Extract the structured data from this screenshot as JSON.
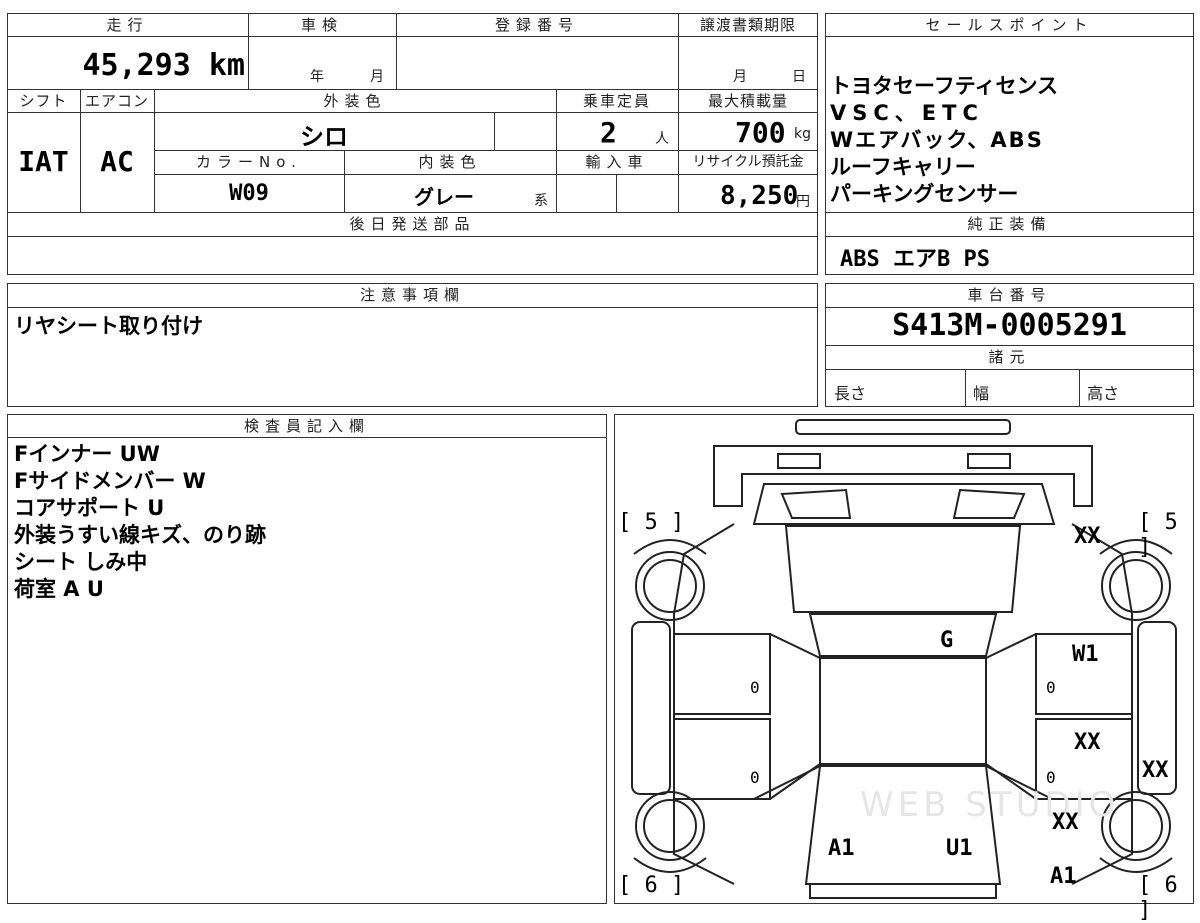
{
  "mileage": {
    "header": "走行",
    "value": "45,293 km"
  },
  "inspection": {
    "header": "車検",
    "year_label": "年",
    "month_label": "月"
  },
  "registration": {
    "header": "登録番号"
  },
  "transfer_deadline": {
    "header": "譲渡書類期限",
    "month_label": "月",
    "day_label": "日"
  },
  "shift": {
    "header": "シフト",
    "value": "IAT"
  },
  "aircon": {
    "header": "エアコン",
    "value": "AC"
  },
  "exterior_color": {
    "header": "外装色",
    "value": "シロ"
  },
  "capacity": {
    "header": "乗車定員",
    "value": "2",
    "unit": "人"
  },
  "max_load": {
    "header": "最大積載量",
    "value": "700",
    "unit": "kg"
  },
  "color_no": {
    "header": "カラーNo.",
    "value": "W09"
  },
  "interior_color": {
    "header": "内装色",
    "value": "グレー",
    "suffix": "系"
  },
  "import_car": {
    "header": "輸入車"
  },
  "recycle_fee": {
    "header": "リサイクル預託金",
    "value": "8,250",
    "unit": "円"
  },
  "later_parts": {
    "header": "後日発送部品"
  },
  "sales_points": {
    "header": "セールスポイント",
    "items": [
      "トヨタセーフティセンス",
      "VSC、ETC",
      "Wエアバック、ABS",
      "ルーフキャリー",
      "パーキングセンサー"
    ]
  },
  "genuine_equipment": {
    "header": "純正装備",
    "value": "ABS エアB PS"
  },
  "notes": {
    "header": "注意事項欄",
    "value": "リヤシート取り付け"
  },
  "chassis_number": {
    "header": "車台番号",
    "value": "S413M-0005291"
  },
  "specs": {
    "header": "諸元",
    "length": "長さ",
    "width": "幅",
    "height": "高さ"
  },
  "inspector": {
    "header": "検査員記入欄",
    "items": [
      "Fインナー UW",
      "Fサイドメンバー W",
      "コアサポート U",
      "外装うすい線キズ、のり跡",
      "シート しみ中",
      "荷室 A U"
    ]
  },
  "diagram": {
    "tire_front_left": "5",
    "tire_front_right": "5",
    "tire_rear_left": "6",
    "tire_rear_right": "6",
    "marks": {
      "front_right_fender": "XX",
      "roof_glass": "G",
      "right_front_door": "W1",
      "right_rear_door": "XX",
      "right_side_step": "XX",
      "rear_right_fender": "XX",
      "rear_left_panel": "A1",
      "rear_right_panel": "U1",
      "rear_right_corner": "A1"
    },
    "zeros": [
      "0",
      "0",
      "0",
      "0"
    ],
    "watermark": "WEB STUDIO"
  }
}
